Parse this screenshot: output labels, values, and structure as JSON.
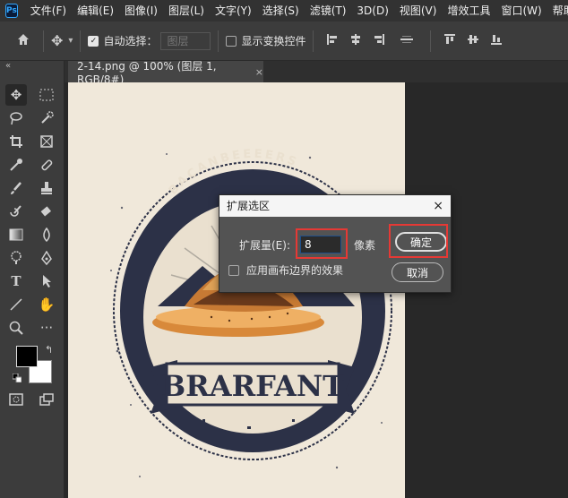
{
  "menubar": {
    "logo": "Ps",
    "items": [
      "文件(F)",
      "编辑(E)",
      "图像(I)",
      "图层(L)",
      "文字(Y)",
      "选择(S)",
      "滤镜(T)",
      "3D(D)",
      "视图(V)",
      "增效工具",
      "窗口(W)",
      "帮助(H)"
    ]
  },
  "optionsbar": {
    "auto_select_label": "自动选择：",
    "auto_select_value": "图层",
    "show_transform_label": "显示变换控件"
  },
  "tab": {
    "title": "2-14.png @ 100% (图层 1, RGB/8#)",
    "close": "×"
  },
  "artwork": {
    "arc_text": "BACANBEEEERS",
    "brand_text": "BRARFANT"
  },
  "dialog": {
    "title": "扩展选区",
    "close": "×",
    "expand_label": "扩展量(E):",
    "expand_value": "8",
    "unit": "像素",
    "checkbox_label": "应用画布边界的效果",
    "ok_label": "确定",
    "cancel_label": "取消"
  },
  "colors": {
    "accent_highlight": "#e53935",
    "foreground_swatch": "#000000",
    "background_swatch": "#ffffff"
  }
}
